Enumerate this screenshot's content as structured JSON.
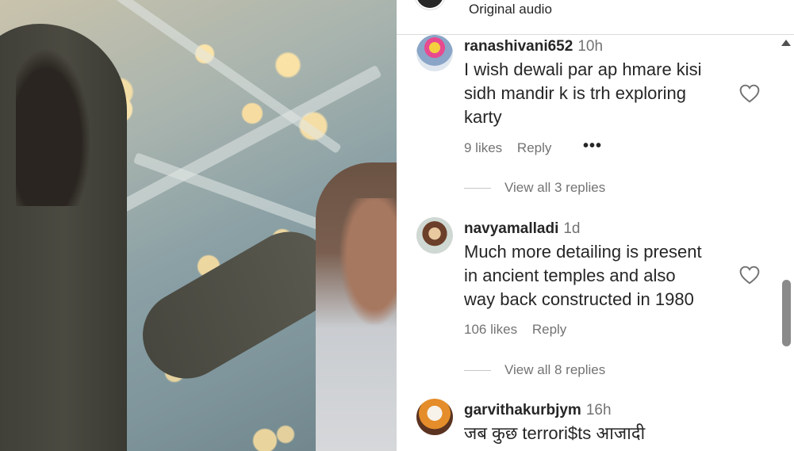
{
  "header": {
    "audio_label": "Original audio"
  },
  "comments": [
    {
      "username": "ranashivani652",
      "time": "10h",
      "lines": [
        "I wish dewali par ap hmare kisi",
        "sidh mandir k is trh exploring",
        "karty"
      ],
      "likes": "9 likes",
      "reply": "Reply",
      "more": "•••",
      "view_replies": "View all 3 replies"
    },
    {
      "username": "navyamalladi",
      "time": "1d",
      "lines": [
        "Much more detailing is present",
        "in ancient temples and also",
        "way back constructed in 1980"
      ],
      "likes": "106 likes",
      "reply": "Reply",
      "view_replies": "View all 8 replies"
    },
    {
      "username": "garvithakurbjym",
      "time": "16h",
      "lines": [
        "जब कुछ terrori$ts आजादी"
      ]
    }
  ],
  "icons": {
    "like": "heart-outline-icon",
    "scroll_up": "scroll-up-arrow-icon"
  }
}
